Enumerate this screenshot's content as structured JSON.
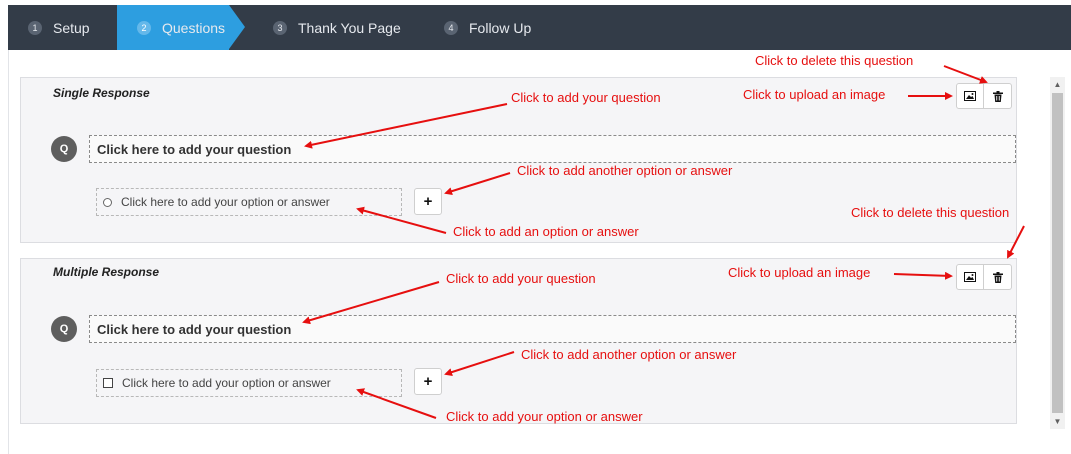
{
  "wizard": {
    "steps": [
      {
        "number": "1",
        "label": "Setup"
      },
      {
        "number": "2",
        "label": "Questions"
      },
      {
        "number": "3",
        "label": "Thank You Page"
      },
      {
        "number": "4",
        "label": "Follow Up"
      }
    ],
    "active_step": "Questions"
  },
  "questions": [
    {
      "type_label": "Single Response",
      "badge": "Q",
      "question_placeholder": "Click here to add your question",
      "option_placeholder": "Click here to add your option or answer",
      "add_option_label": "+"
    },
    {
      "type_label": "Multiple Response",
      "badge": "Q",
      "question_placeholder": "Click here to add your question",
      "option_placeholder": "Click here to add your option or answer",
      "add_option_label": "+"
    }
  ],
  "annotations": {
    "delete_1": "Click to delete this question",
    "upload_1": "Click to upload an image",
    "question_1": "Click to add your question",
    "another_option_1": "Click to add another option or answer",
    "option_1": "Click to add an option or answer",
    "delete_2": "Click to delete this question",
    "upload_2": "Click to upload an image",
    "question_2": "Click to add your question",
    "another_option_2": "Click to add another option or answer",
    "option_2": "Click to add your option or answer"
  },
  "icons": [
    "image-icon",
    "trash-icon",
    "plus-icon",
    "radio-icon",
    "checkbox-icon",
    "arrow-up-icon",
    "arrow-down-icon"
  ],
  "colors": {
    "wizard_bg": "#333c48",
    "active_step": "#2d9ee0",
    "annotation": "#e60f0f"
  }
}
